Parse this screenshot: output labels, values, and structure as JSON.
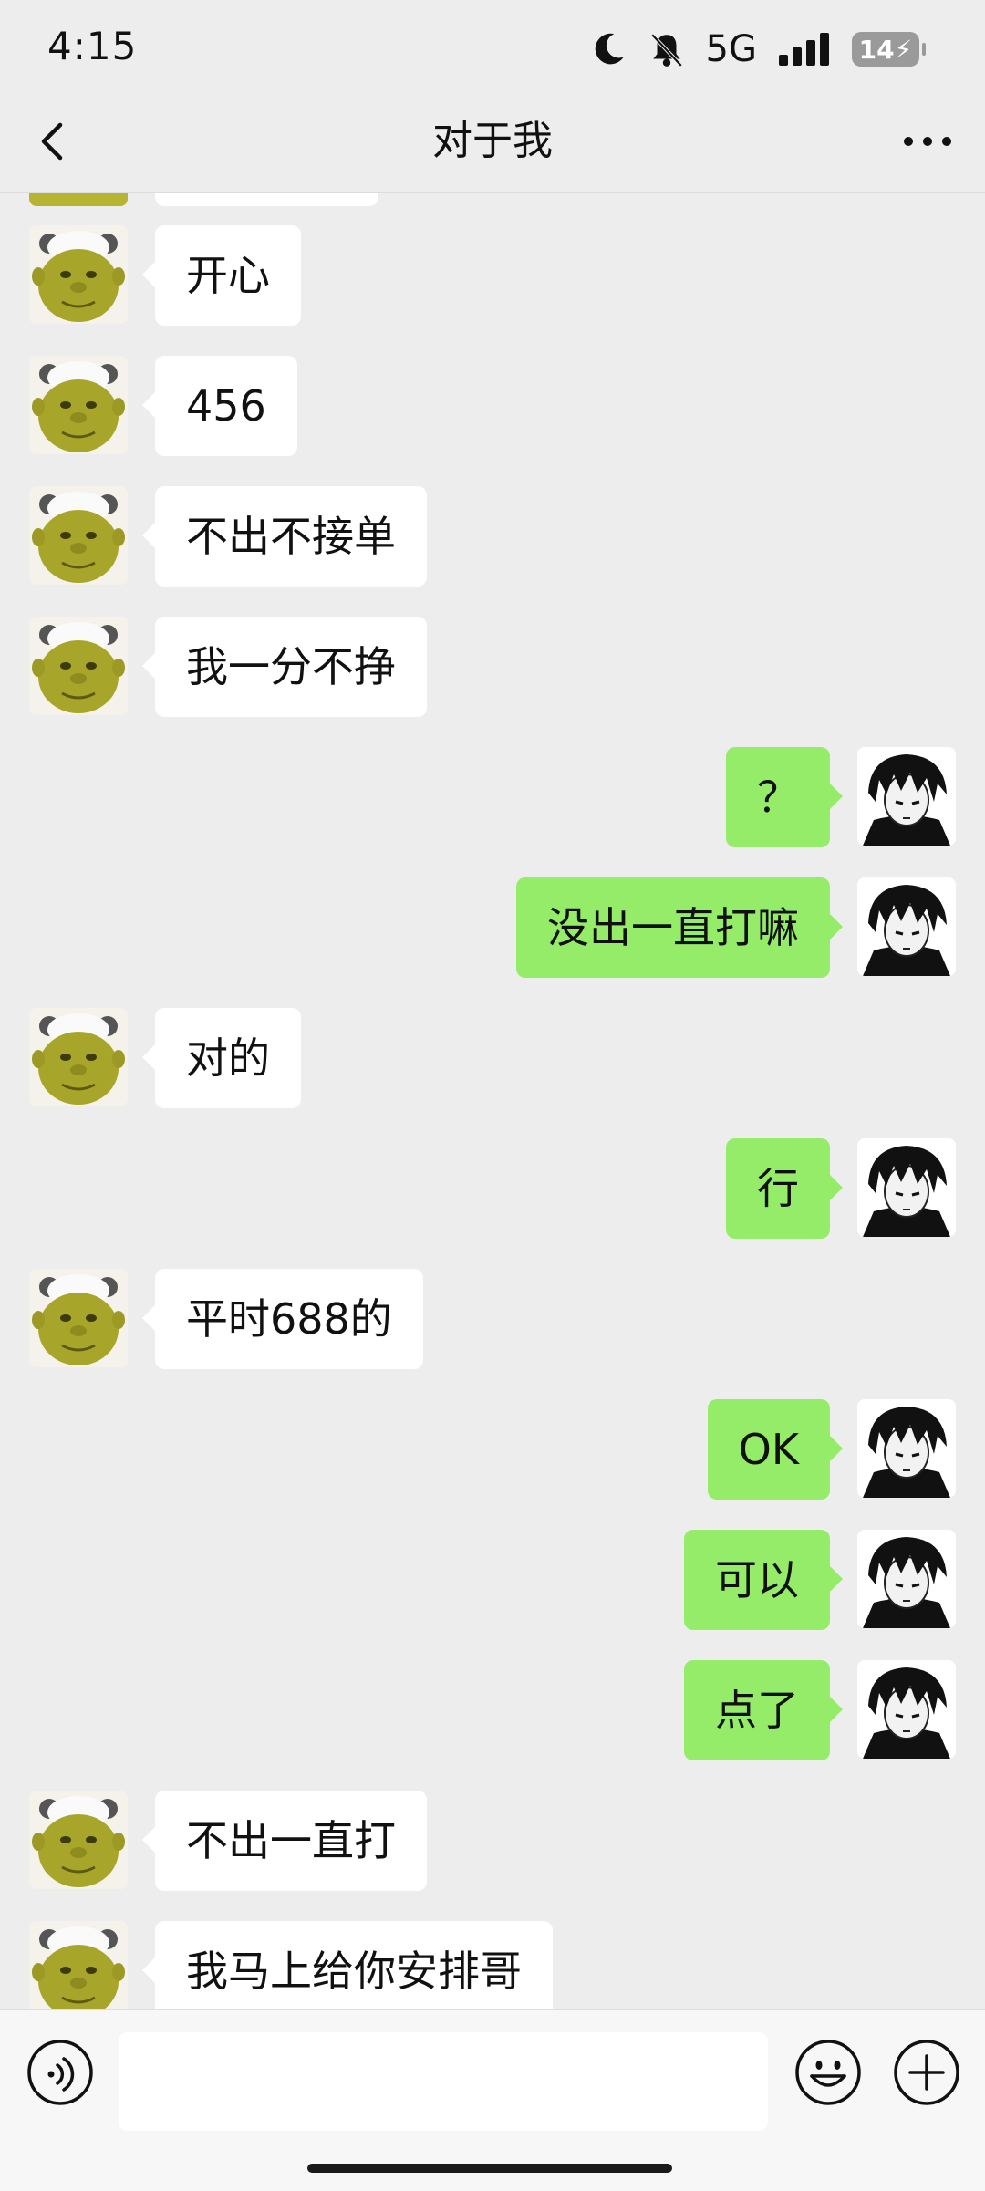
{
  "status_bar": {
    "time": "4:15",
    "network": "5G",
    "battery": "14"
  },
  "nav": {
    "title": "对于我"
  },
  "messages": [
    {
      "side": "left",
      "text": "开心"
    },
    {
      "side": "left",
      "text": "456"
    },
    {
      "side": "left",
      "text": "不出不接单"
    },
    {
      "side": "left",
      "text": "我一分不挣"
    },
    {
      "side": "right",
      "text": "？"
    },
    {
      "side": "right",
      "text": "没出一直打嘛"
    },
    {
      "side": "left",
      "text": "对的"
    },
    {
      "side": "right",
      "text": "行"
    },
    {
      "side": "left",
      "text": "平时688的"
    },
    {
      "side": "right",
      "text": "OK"
    },
    {
      "side": "right",
      "text": "可以"
    },
    {
      "side": "right",
      "text": "点了"
    },
    {
      "side": "left",
      "text": "不出一直打"
    },
    {
      "side": "left",
      "text": "我马上给你安排哥"
    }
  ],
  "input_bar": {
    "placeholder": "",
    "icons": [
      "voice-icon",
      "emoji-icon",
      "plus-icon"
    ]
  },
  "colors": {
    "background": "#ededed",
    "self_bubble": "#95ec69",
    "other_bubble": "#ffffff"
  }
}
